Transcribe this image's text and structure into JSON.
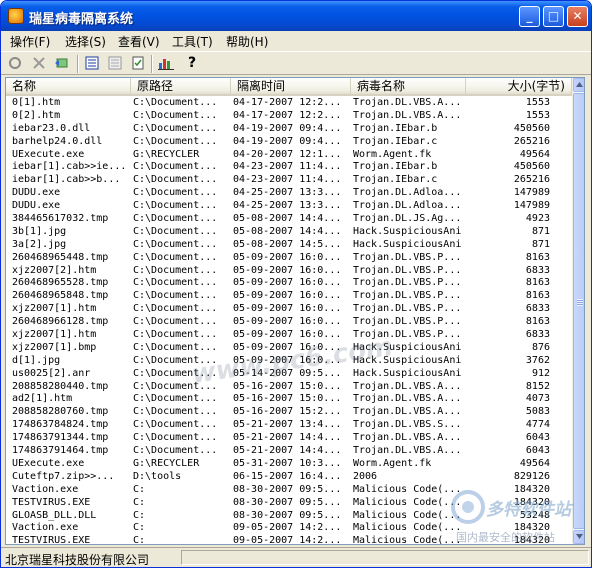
{
  "window": {
    "title": "瑞星病毒隔离系统"
  },
  "menu": [
    "操作(F)",
    "选择(S)",
    "查看(V)",
    "工具(T)",
    "帮助(H)"
  ],
  "toolbar": [
    "refresh-icon",
    "delete-icon",
    "restore-icon",
    "details-view-icon",
    "list-view-icon",
    "properties-icon",
    "statistics-icon",
    "help-icon"
  ],
  "columns": [
    "名称",
    "原路径",
    "隔离时间",
    "病毒名称",
    "大小(字节)"
  ],
  "rows": [
    [
      "0[1].htm",
      "C:\\Document...",
      "04-17-2007 12:2...",
      "Trojan.DL.VBS.A...",
      "1553"
    ],
    [
      "0[2].htm",
      "C:\\Document...",
      "04-17-2007 12:2...",
      "Trojan.DL.VBS.A...",
      "1553"
    ],
    [
      "iebar23.0.dll",
      "C:\\Document...",
      "04-19-2007 09:4...",
      "Trojan.IEbar.b",
      "450560"
    ],
    [
      "barhelp24.0.dll",
      "C:\\Document...",
      "04-19-2007 09:4...",
      "Trojan.IEbar.c",
      "265216"
    ],
    [
      "UExecute.exe",
      "G:\\RECYCLER",
      "04-20-2007 12:1...",
      "Worm.Agent.fk",
      "49564"
    ],
    [
      "iebar[1].cab>>ie...",
      "C:\\Document...",
      "04-23-2007 11:4...",
      "Trojan.IEbar.b",
      "450560"
    ],
    [
      "iebar[1].cab>>b...",
      "C:\\Document...",
      "04-23-2007 11:4...",
      "Trojan.IEbar.c",
      "265216"
    ],
    [
      "DUDU.exe",
      "C:\\Document...",
      "04-25-2007 13:3...",
      "Trojan.DL.Adloa...",
      "147989"
    ],
    [
      "DUDU.exe",
      "C:\\Document...",
      "04-25-2007 13:3...",
      "Trojan.DL.Adloa...",
      "147989"
    ],
    [
      "384465617032.tmp",
      "C:\\Document...",
      "05-08-2007 14:4...",
      "Trojan.DL.JS.Ag...",
      "4923"
    ],
    [
      "3b[1].jpg",
      "C:\\Document...",
      "05-08-2007 14:4...",
      "Hack.SuspiciousAni",
      "871"
    ],
    [
      "3a[2].jpg",
      "C:\\Document...",
      "05-08-2007 14:5...",
      "Hack.SuspiciousAni",
      "871"
    ],
    [
      "260468965448.tmp",
      "C:\\Document...",
      "05-09-2007 16:0...",
      "Trojan.DL.VBS.P...",
      "8163"
    ],
    [
      "xjz2007[2].htm",
      "C:\\Document...",
      "05-09-2007 16:0...",
      "Trojan.DL.VBS.P...",
      "6833"
    ],
    [
      "260468965528.tmp",
      "C:\\Document...",
      "05-09-2007 16:0...",
      "Trojan.DL.VBS.P...",
      "8163"
    ],
    [
      "260468965848.tmp",
      "C:\\Document...",
      "05-09-2007 16:0...",
      "Trojan.DL.VBS.P...",
      "8163"
    ],
    [
      "xjz2007[1].htm",
      "C:\\Document...",
      "05-09-2007 16:0...",
      "Trojan.DL.VBS.P...",
      "6833"
    ],
    [
      "260468966128.tmp",
      "C:\\Document...",
      "05-09-2007 16:0...",
      "Trojan.DL.VBS.P...",
      "8163"
    ],
    [
      "xjz2007[1].htm",
      "C:\\Document...",
      "05-09-2007 16:0...",
      "Trojan.DL.VBS.P...",
      "6833"
    ],
    [
      "xjz2007[1].bmp",
      "C:\\Document...",
      "05-09-2007 16:0...",
      "Hack.SuspiciousAni",
      "876"
    ],
    [
      "d[1].jpg",
      "C:\\Document...",
      "05-09-2007 16:0...",
      "Hack.SuspiciousAni",
      "3762"
    ],
    [
      "us0025[2].anr",
      "C:\\Document...",
      "05-14-2007 09:5...",
      "Hack.SuspiciousAni",
      "912"
    ],
    [
      "208858280440.tmp",
      "C:\\Document...",
      "05-16-2007 15:0...",
      "Trojan.DL.VBS.A...",
      "8152"
    ],
    [
      "ad2[1].htm",
      "C:\\Document...",
      "05-16-2007 15:0...",
      "Trojan.DL.VBS.A...",
      "4073"
    ],
    [
      "208858280760.tmp",
      "C:\\Document...",
      "05-16-2007 15:2...",
      "Trojan.DL.VBS.A...",
      "5083"
    ],
    [
      "174863784824.tmp",
      "C:\\Document...",
      "05-21-2007 13:4...",
      "Trojan.DL.VBS.S...",
      "4774"
    ],
    [
      "174863791344.tmp",
      "C:\\Document...",
      "05-21-2007 14:4...",
      "Trojan.DL.VBS.A...",
      "6043"
    ],
    [
      "174863791464.tmp",
      "C:\\Document...",
      "05-21-2007 14:4...",
      "Trojan.DL.VBS.A...",
      "6043"
    ],
    [
      "UExecute.exe",
      "G:\\RECYCLER",
      "05-31-2007 10:3...",
      "Worm.Agent.fk",
      "49564"
    ],
    [
      "Cuteftp7.zip>>...",
      "D:\\tools",
      "06-15-2007 16:4...",
      "2006",
      "829126"
    ],
    [
      "Vaction.exe",
      "C:",
      "08-30-2007 09:5...",
      "Malicious Code(...",
      "184320"
    ],
    [
      "TESTVIRUS.EXE",
      "C:",
      "08-30-2007 09:5...",
      "Malicious Code(...",
      "184320"
    ],
    [
      "GLOASB_DLL.DLL",
      "C:",
      "08-30-2007 09:5...",
      "Malicious Code(...",
      "53248"
    ],
    [
      "Vaction.exe",
      "C:",
      "09-05-2007 14:2...",
      "Malicious Code(...",
      "184320"
    ],
    [
      "TESTVIRUS.EXE",
      "C:",
      "09-05-2007 14:2...",
      "Malicious Code(...",
      "184320"
    ]
  ],
  "watermark": "www.pc6.com",
  "corner_logo": {
    "title": "多特软件站",
    "subtitle": "国内最安全的软件站"
  },
  "status": {
    "company": "北京瑞星科技股份有限公司"
  }
}
